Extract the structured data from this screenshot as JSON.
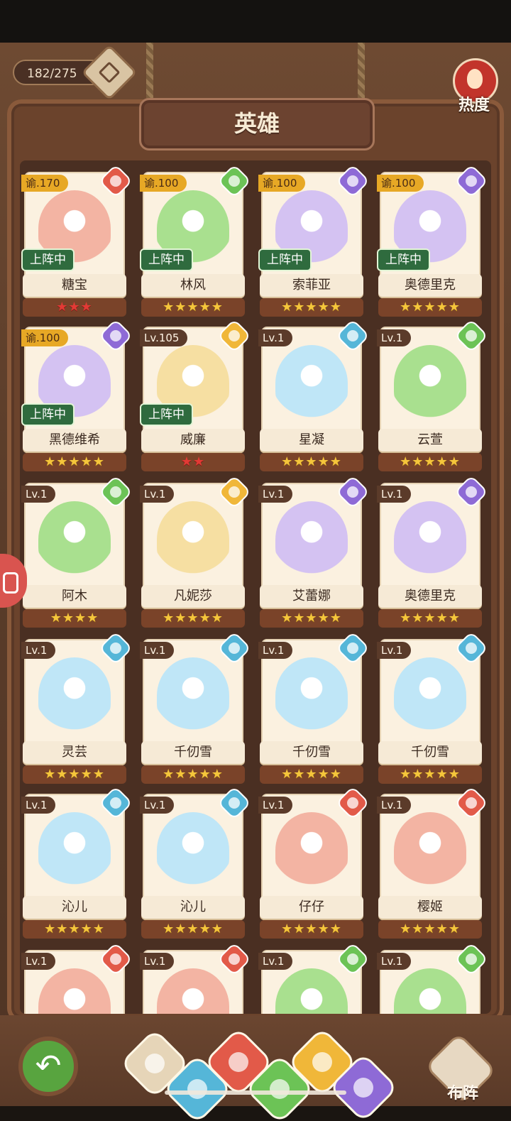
{
  "header": {
    "counter": "182/275",
    "title": "英雄",
    "heat_label": "热度"
  },
  "colors": {
    "fire": "#e25a49",
    "grass": "#6cc356",
    "water": "#55b6d8",
    "moon": "#8e6ad6",
    "sun": "#f0b739"
  },
  "heroes": [
    {
      "level": "谕.170",
      "level_style": "gold",
      "element": "fire",
      "name": "糖宝",
      "stars": "★★★",
      "star_color": "red",
      "status": "上阵中"
    },
    {
      "level": "谕.100",
      "level_style": "gold",
      "element": "grass",
      "name": "林风",
      "stars": "★★★★★",
      "star_color": "gold",
      "status": "上阵中"
    },
    {
      "level": "谕.100",
      "level_style": "gold",
      "element": "moon",
      "name": "索菲亚",
      "stars": "★★★★★",
      "star_color": "gold",
      "status": "上阵中"
    },
    {
      "level": "谕.100",
      "level_style": "gold",
      "element": "moon",
      "name": "奥德里克",
      "stars": "★★★★★",
      "star_color": "gold",
      "status": "上阵中"
    },
    {
      "level": "谕.100",
      "level_style": "gold",
      "element": "moon",
      "name": "黑德维希",
      "stars": "★★★★★",
      "star_color": "gold",
      "status": "上阵中"
    },
    {
      "level": "Lv.105",
      "level_style": "dark",
      "element": "sun",
      "name": "威廉",
      "stars": "★★",
      "star_color": "red",
      "status": "上阵中"
    },
    {
      "level": "Lv.1",
      "level_style": "dark",
      "element": "water",
      "name": "星凝",
      "stars": "★★★★★",
      "star_color": "gold",
      "status": ""
    },
    {
      "level": "Lv.1",
      "level_style": "dark",
      "element": "grass",
      "name": "云萱",
      "stars": "★★★★★",
      "star_color": "gold",
      "status": ""
    },
    {
      "level": "Lv.1",
      "level_style": "dark",
      "element": "grass",
      "name": "阿木",
      "stars": "★★★★",
      "star_color": "gold",
      "status": ""
    },
    {
      "level": "Lv.1",
      "level_style": "dark",
      "element": "sun",
      "name": "凡妮莎",
      "stars": "★★★★★",
      "star_color": "gold",
      "status": ""
    },
    {
      "level": "Lv.1",
      "level_style": "dark",
      "element": "moon",
      "name": "艾蕾娜",
      "stars": "★★★★★",
      "star_color": "gold",
      "status": ""
    },
    {
      "level": "Lv.1",
      "level_style": "dark",
      "element": "moon",
      "name": "奥德里克",
      "stars": "★★★★★",
      "star_color": "gold",
      "status": ""
    },
    {
      "level": "Lv.1",
      "level_style": "dark",
      "element": "water",
      "name": "灵芸",
      "stars": "★★★★★",
      "star_color": "gold",
      "status": ""
    },
    {
      "level": "Lv.1",
      "level_style": "dark",
      "element": "water",
      "name": "千仞雪",
      "stars": "★★★★★",
      "star_color": "gold",
      "status": ""
    },
    {
      "level": "Lv.1",
      "level_style": "dark",
      "element": "water",
      "name": "千仞雪",
      "stars": "★★★★★",
      "star_color": "gold",
      "status": ""
    },
    {
      "level": "Lv.1",
      "level_style": "dark",
      "element": "water",
      "name": "千仞雪",
      "stars": "★★★★★",
      "star_color": "gold",
      "status": ""
    },
    {
      "level": "Lv.1",
      "level_style": "dark",
      "element": "water",
      "name": "沁儿",
      "stars": "★★★★★",
      "star_color": "gold",
      "status": ""
    },
    {
      "level": "Lv.1",
      "level_style": "dark",
      "element": "water",
      "name": "沁儿",
      "stars": "★★★★★",
      "star_color": "gold",
      "status": ""
    },
    {
      "level": "Lv.1",
      "level_style": "dark",
      "element": "fire",
      "name": "仔仔",
      "stars": "★★★★★",
      "star_color": "gold",
      "status": ""
    },
    {
      "level": "Lv.1",
      "level_style": "dark",
      "element": "fire",
      "name": "樱姬",
      "stars": "★★★★★",
      "star_color": "gold",
      "status": ""
    },
    {
      "level": "Lv.1",
      "level_style": "dark",
      "element": "fire",
      "name": "",
      "stars": "",
      "star_color": "gold",
      "status": ""
    },
    {
      "level": "Lv.1",
      "level_style": "dark",
      "element": "fire",
      "name": "",
      "stars": "",
      "star_color": "gold",
      "status": ""
    },
    {
      "level": "Lv.1",
      "level_style": "dark",
      "element": "grass",
      "name": "",
      "stars": "",
      "star_color": "gold",
      "status": ""
    },
    {
      "level": "Lv.1",
      "level_style": "dark",
      "element": "grass",
      "name": "",
      "stars": "",
      "star_color": "gold",
      "status": ""
    }
  ],
  "bottom": {
    "formation_label": "布阵",
    "filters": [
      "all",
      "water",
      "fire",
      "grass",
      "sun",
      "moon"
    ]
  }
}
